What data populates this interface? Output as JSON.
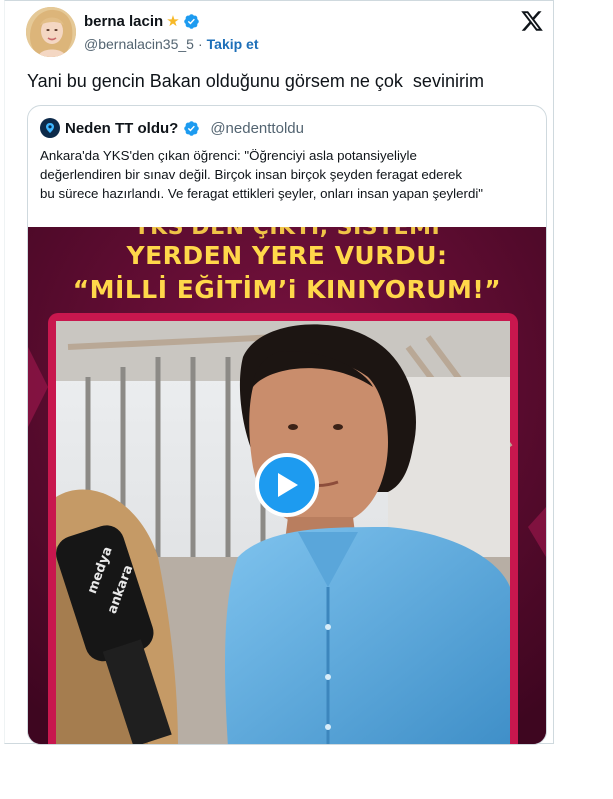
{
  "author": {
    "name": "berna lacin",
    "badge_star": "★",
    "handle": "@bernalacin35_5",
    "separator": "·",
    "follow_label": "Takip et"
  },
  "tweet_text": "Yani bu gencin Bakan olduğunu görsem ne çok  sevinirim",
  "quoted": {
    "name": "Neden TT oldu?",
    "handle": "@nedenttoldu",
    "text_lines": [
      "Ankara'da YKS'den çıkan öğrenci: \"Öğrenciyi asla potansiyeliyle",
      "değerlendiren bir sınav değil. Birçok insan birçok şeyden feragat ederek",
      "bu sürece hazırlandı. Ve feragat ettikleri şeyler, onları insan yapan şeylerdi\""
    ],
    "video": {
      "headline_lines": [
        "YKS'DEN ÇIKTI, SİSTEMİ",
        "YERDEN YERE VURDU:",
        "“MİLLİ EĞİTİM’i KINIYORUM!”"
      ],
      "mic_text_1": "medya",
      "mic_text_2": "ankara"
    }
  },
  "colors": {
    "accent": "#1d9bf0",
    "follow": "#1d6fb8",
    "headline": "#ffd84a",
    "media_bg": "#5a0a2c",
    "frame": "#c8174e"
  },
  "icons": [
    "x-logo-icon",
    "verified-badge-icon",
    "play-icon",
    "star-icon"
  ]
}
